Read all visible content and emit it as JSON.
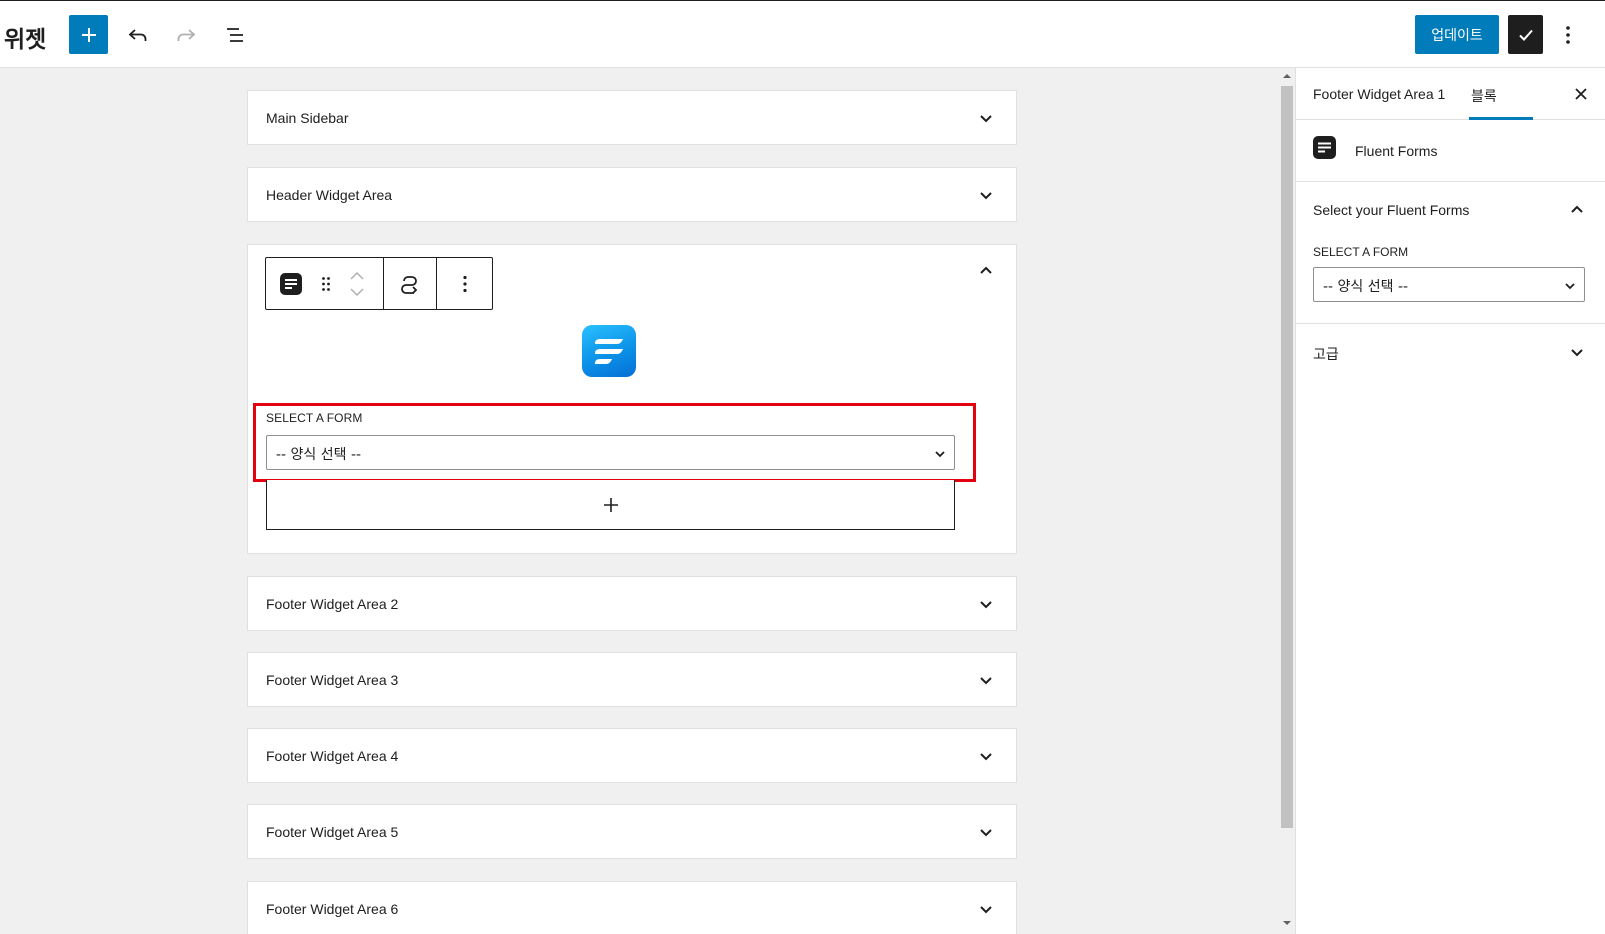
{
  "header": {
    "title": "위젯",
    "add_icon": "plus-icon",
    "undo_icon": "undo-icon",
    "redo_icon": "redo-icon",
    "list_view_icon": "list-view-icon",
    "update_label": "업데이트",
    "publish_check_icon": "check-icon",
    "options_icon": "vertical-dots-icon",
    "accent_color": "#007cba"
  },
  "widget_areas": [
    {
      "label": "Main Sidebar",
      "expanded": false
    },
    {
      "label": "Header Widget Area",
      "expanded": false
    },
    {
      "label": "Footer Widget Area 1",
      "expanded": true
    },
    {
      "label": "Footer Widget Area 2",
      "expanded": false
    },
    {
      "label": "Footer Widget Area 3",
      "expanded": false
    },
    {
      "label": "Footer Widget Area 4",
      "expanded": false
    },
    {
      "label": "Footer Widget Area 5",
      "expanded": false
    },
    {
      "label": "Footer Widget Area 6",
      "expanded": false
    }
  ],
  "block": {
    "select_label": "SELECT A FORM",
    "select_value": "-- 양식 선택 --",
    "highlight_color": "#e3000f",
    "appender_icon": "plus-icon"
  },
  "sidebar": {
    "tab_area": "Footer Widget Area 1",
    "tab_block": "블록",
    "close_icon": "close-icon",
    "block_name": "Fluent Forms",
    "panel_title": "Select your Fluent Forms",
    "select_label": "SELECT A FORM",
    "select_value": "-- 양식 선택 --",
    "advanced_title": "고급"
  }
}
